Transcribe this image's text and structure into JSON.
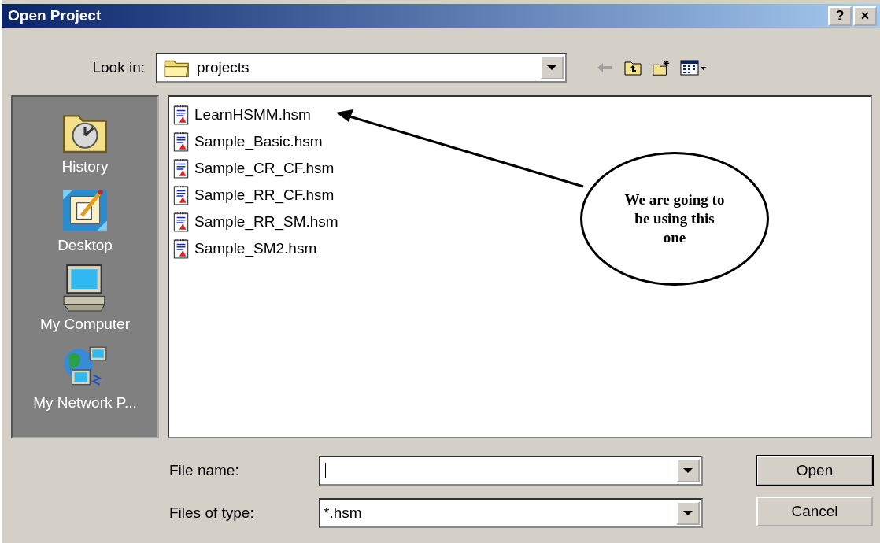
{
  "window": {
    "title": "Open Project",
    "title_buttons": [
      "?",
      "×"
    ]
  },
  "look_in": {
    "label": "Look in:",
    "value": "projects"
  },
  "toolbar": [
    {
      "kind": "back"
    },
    {
      "kind": "up"
    },
    {
      "kind": "new-folder"
    },
    {
      "kind": "views"
    }
  ],
  "places": [
    {
      "label": "History",
      "kind": "history"
    },
    {
      "label": "Desktop",
      "kind": "desktop"
    },
    {
      "label": "My Computer",
      "kind": "computer"
    },
    {
      "label": "My Network P...",
      "kind": "network"
    }
  ],
  "files": [
    {
      "name": "LearnHSMM.hsm"
    },
    {
      "name": "Sample_Basic.hsm"
    },
    {
      "name": "Sample_CR_CF.hsm"
    },
    {
      "name": "Sample_RR_CF.hsm"
    },
    {
      "name": "Sample_RR_SM.hsm"
    },
    {
      "name": "Sample_SM2.hsm"
    }
  ],
  "callout": {
    "text": "We are going to be using this one"
  },
  "file_name": {
    "label": "File name:"
  },
  "files_of_type": {
    "label": "Files of type:",
    "value": "*.hsm"
  },
  "buttons": [
    {
      "label": "Open",
      "default": true
    },
    {
      "label": "Cancel",
      "default": false
    }
  ]
}
